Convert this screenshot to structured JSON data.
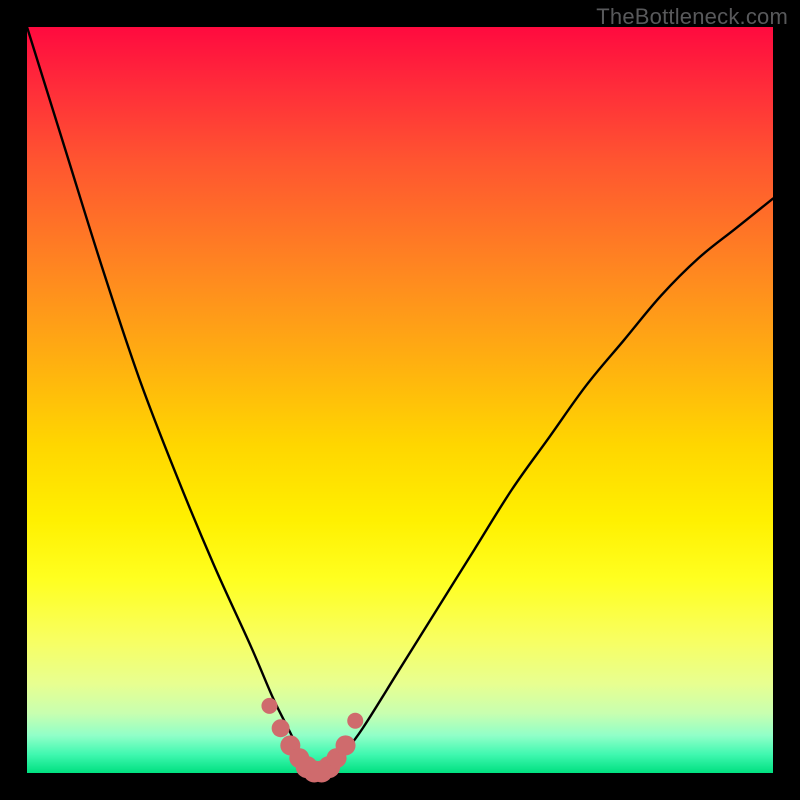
{
  "watermark": "TheBottleneck.com",
  "chart_data": {
    "type": "line",
    "title": "",
    "xlabel": "",
    "ylabel": "",
    "xlim": [
      0,
      100
    ],
    "ylim": [
      0,
      100
    ],
    "grid": false,
    "legend": false,
    "notes": "Bottleneck-style V-curve. Y axis reads as mismatch/penalty percentage; minimum ~0 around x≈37–40 where salmon markers sit. Axes and ticks are not drawn.",
    "series": [
      {
        "name": "curve",
        "x": [
          0,
          5,
          10,
          15,
          20,
          25,
          30,
          33,
          35,
          37,
          38,
          39,
          40,
          41,
          42,
          45,
          50,
          55,
          60,
          65,
          70,
          75,
          80,
          85,
          90,
          95,
          100
        ],
        "values": [
          100,
          84,
          68,
          53,
          40,
          28,
          17,
          10,
          6,
          2,
          0.5,
          0,
          0,
          0.5,
          2,
          6,
          14,
          22,
          30,
          38,
          45,
          52,
          58,
          64,
          69,
          73,
          77
        ]
      }
    ],
    "markers": {
      "name": "highlight-dots",
      "color": "#cf6b6d",
      "x": [
        32.5,
        34.0,
        35.3,
        36.5,
        37.5,
        38.5,
        39.5,
        40.5,
        41.5,
        42.7,
        44.0
      ],
      "values": [
        9.0,
        6.0,
        3.7,
        2.0,
        0.8,
        0.2,
        0.2,
        0.8,
        2.0,
        3.7,
        7.0
      ],
      "size": [
        8,
        9,
        10,
        10,
        11,
        11,
        11,
        11,
        10,
        10,
        8
      ]
    },
    "background_gradient": {
      "top": "#ff0a3f",
      "mid": "#fff000",
      "bottom": "#00e080"
    }
  }
}
